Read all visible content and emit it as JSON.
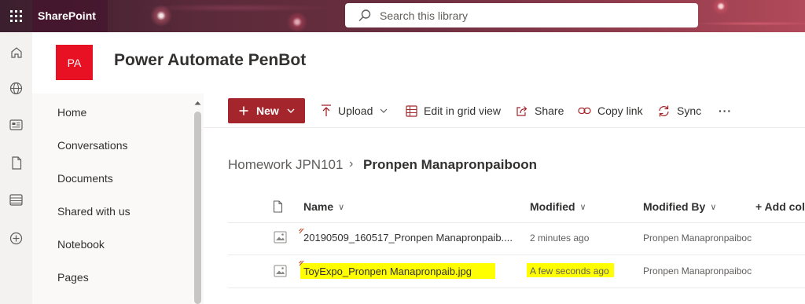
{
  "suite": {
    "app_name": "SharePoint",
    "search_placeholder": "Search this library"
  },
  "site": {
    "logo_initials": "PA",
    "logo_color": "#e81123",
    "title": "Power Automate PenBot"
  },
  "left_nav": {
    "items": [
      "Home",
      "Conversations",
      "Documents",
      "Shared with us",
      "Notebook",
      "Pages"
    ]
  },
  "command_bar": {
    "new_label": "New",
    "upload_label": "Upload",
    "edit_grid_label": "Edit in grid view",
    "share_label": "Share",
    "copy_link_label": "Copy link",
    "sync_label": "Sync",
    "more_label": "···"
  },
  "breadcrumb": {
    "parent": "Homework JPN101",
    "separator": "›",
    "current": "Pronpen Manapronpaiboon"
  },
  "list": {
    "columns": {
      "name": "Name",
      "modified": "Modified",
      "modified_by": "Modified By",
      "add_column": "+ Add colu"
    },
    "rows": [
      {
        "name": "20190509_160517_Pronpen Manapronpaib....",
        "modified": "2 minutes ago",
        "modified_by": "Pronpen Manapronpaiboc",
        "highlighted": false
      },
      {
        "name": "ToyExpo_Pronpen Manapronpaib.jpg",
        "modified": "A few seconds ago",
        "modified_by": "Pronpen Manapronpaiboc",
        "highlighted": true
      }
    ]
  },
  "colors": {
    "accent": "#a4262c",
    "highlight": "#ffff00"
  }
}
